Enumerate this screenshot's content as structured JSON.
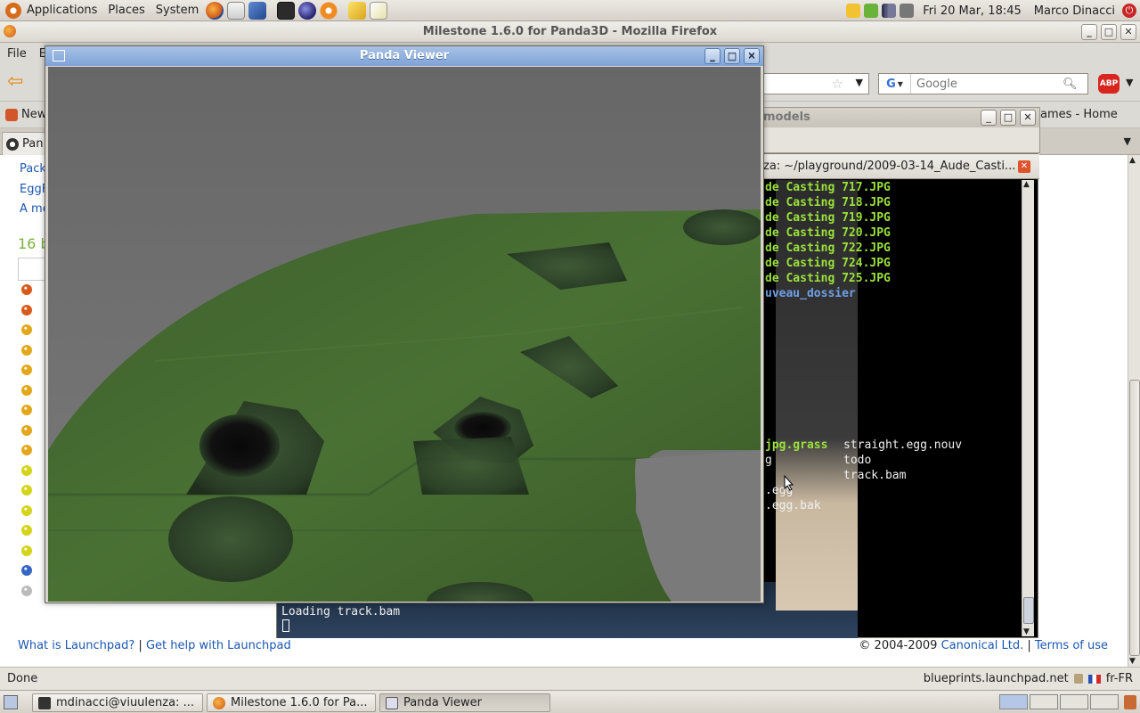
{
  "top_panel": {
    "menus": [
      "Applications",
      "Places",
      "System"
    ],
    "clock": "Fri 20 Mar, 18:45",
    "user": "Marco Dinacci"
  },
  "firefox": {
    "title": "Milestone 1.6.0 for Panda3D - Mozilla Firefox",
    "menu_file": "File",
    "menu_edit": "E",
    "search_placeholder": "Google",
    "search_engine": "G",
    "abp": "ABP",
    "bookmark_new": "New",
    "bookmark_games": "ames - Home",
    "tab_label": "Pan",
    "status_left": "Done",
    "status_host": "blueprints.launchpad.net",
    "status_locale": "fr-FR"
  },
  "webpage": {
    "side_links": [
      "Pack",
      "EggF",
      "A me"
    ],
    "heading": "16 b",
    "footer_link1": "What is Launchpad?",
    "footer_sep": "|",
    "footer_link2": "Get help with Launchpad",
    "copyright": "© 2004-2009",
    "canonical": "Canonical Ltd.",
    "terms": "Terms of use",
    "bug_colors": [
      "#d95a1a",
      "#d95a1a",
      "#e3a71b",
      "#e3a71b",
      "#e3a71b",
      "#e3a71b",
      "#e3a71b",
      "#e3a71b",
      "#e3a71b",
      "#d4d41b",
      "#d4d41b",
      "#d4d41b",
      "#d4d41b",
      "#d4d41b",
      "#3566c6",
      "#bbbbbb"
    ]
  },
  "models_window": {
    "title": "models"
  },
  "terminal": {
    "title": "za: ~/playground/2009-03-14_Aude_Casti...",
    "jpg_lines": [
      "de Casting 717.JPG",
      "de Casting 718.JPG",
      "de Casting 719.JPG",
      "de Casting 720.JPG",
      "de Casting 722.JPG",
      "de Casting 724.JPG",
      "de Casting 725.JPG"
    ],
    "dir_line": "uveau_dossier",
    "ls_col1": [
      "jpg.grass",
      "g",
      "",
      ".egg",
      ".egg.bak"
    ],
    "ls_col2": [
      "straight.egg.nouv",
      "todo",
      "track.bam",
      "",
      ""
    ],
    "loading": "Loading track.bam"
  },
  "panda": {
    "title": "Panda Viewer"
  },
  "taskbar": {
    "tasks": [
      "mdinacci@viuulenza: ...",
      "Milestone 1.6.0 for Pa...",
      "Panda Viewer"
    ]
  }
}
